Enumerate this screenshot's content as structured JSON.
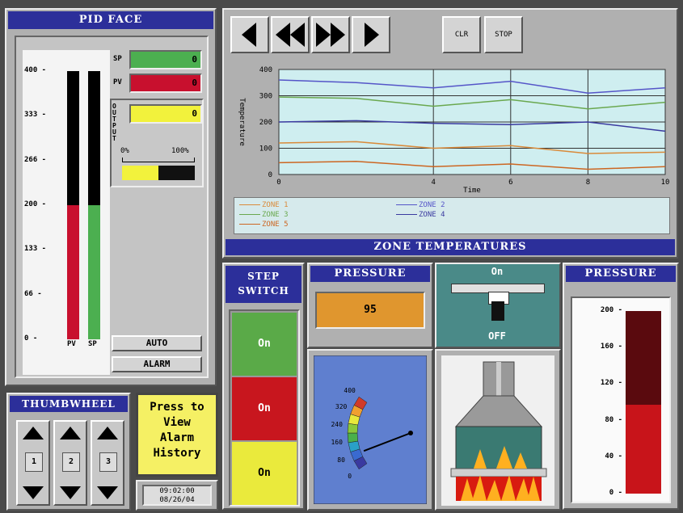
{
  "pid_face": {
    "title": "PID FACE",
    "y_ticks": [
      "400",
      "333",
      "266",
      "200",
      "133",
      "66",
      "0"
    ],
    "pv_label": "PV",
    "sp_label": "SP",
    "pv_fraction": 0.5,
    "sp_fraction": 0.5,
    "sp_tag": "SP",
    "pv_tag": "PV",
    "sp_value": "0",
    "pv_value": "0",
    "output_tag": "OUTPUT",
    "output_value": "0",
    "pct_low": "0%",
    "pct_high": "100%",
    "output_fraction": 0.5,
    "auto_label": "AUTO",
    "alarm_label": "ALARM",
    "colors": {
      "pv": "#c8102e",
      "sp": "#4caf50",
      "output": "#f2f23c"
    }
  },
  "trend": {
    "clr_label": "CLR",
    "stop_label": "STOP",
    "nav_icons": [
      "prev-icon",
      "rewind-icon",
      "fast-forward-icon",
      "next-icon"
    ],
    "title": "ZONE TEMPERATURES",
    "ylabel": "Temperature",
    "xlabel": "Time"
  },
  "chart_data": {
    "type": "line",
    "xlabel": "Time",
    "ylabel": "Temperature",
    "title": "ZONE TEMPERATURES",
    "xlim": [
      0,
      10
    ],
    "ylim": [
      0,
      400
    ],
    "x_ticks": [
      "0",
      "4",
      "6",
      "8",
      "10"
    ],
    "y_ticks": [
      "0",
      "100",
      "200",
      "300",
      "400"
    ],
    "x": [
      0,
      2,
      4,
      6,
      8,
      10
    ],
    "series": [
      {
        "name": "ZONE 1",
        "color": "#d98a3a",
        "values": [
          120,
          125,
          100,
          110,
          80,
          85
        ]
      },
      {
        "name": "ZONE 2",
        "color": "#5555c8",
        "values": [
          360,
          350,
          330,
          355,
          310,
          330
        ]
      },
      {
        "name": "ZONE 3",
        "color": "#6aa84f",
        "values": [
          295,
          290,
          260,
          285,
          250,
          275
        ]
      },
      {
        "name": "ZONE 4",
        "color": "#3a3aa0",
        "values": [
          200,
          205,
          195,
          190,
          200,
          165
        ]
      },
      {
        "name": "ZONE 5",
        "color": "#cc6622",
        "values": [
          45,
          50,
          30,
          40,
          20,
          30
        ]
      }
    ]
  },
  "legend": [
    {
      "name": "ZONE 1",
      "color": "#d98a3a"
    },
    {
      "name": "ZONE 2",
      "color": "#5555c8"
    },
    {
      "name": "ZONE 3",
      "color": "#6aa84f"
    },
    {
      "name": "ZONE 4",
      "color": "#3a3aa0"
    },
    {
      "name": "ZONE 5",
      "color": "#cc6622"
    }
  ],
  "step_switch": {
    "title_line1": "STEP",
    "title_line2": "SWITCH",
    "states": [
      {
        "label": "On",
        "color": "#5aaa48"
      },
      {
        "label": "On",
        "color": "#c8161e"
      },
      {
        "label": "On",
        "color": "#eaea3c"
      }
    ]
  },
  "pressure_num": {
    "title": "PRESSURE",
    "value": "95",
    "color": "#e0962e"
  },
  "gauge": {
    "ticks": [
      "400",
      "320",
      "240",
      "160",
      "80",
      "0"
    ],
    "value": 80,
    "max": 400
  },
  "toggle": {
    "on_label": "On",
    "off_label": "OFF"
  },
  "pressure_bar": {
    "title": "PRESSURE",
    "ticks": [
      "200",
      "160",
      "120",
      "80",
      "40",
      "0"
    ],
    "value": 97,
    "max": 200
  },
  "thumbwheel": {
    "title": "THUMBWHEEL",
    "digits": [
      "1",
      "2",
      "3"
    ]
  },
  "alarm_button": {
    "line1": "Press to",
    "line2": "View",
    "line3": "Alarm",
    "line4": "History"
  },
  "clock": {
    "time": "09:02:00",
    "date": "08/26/04"
  }
}
